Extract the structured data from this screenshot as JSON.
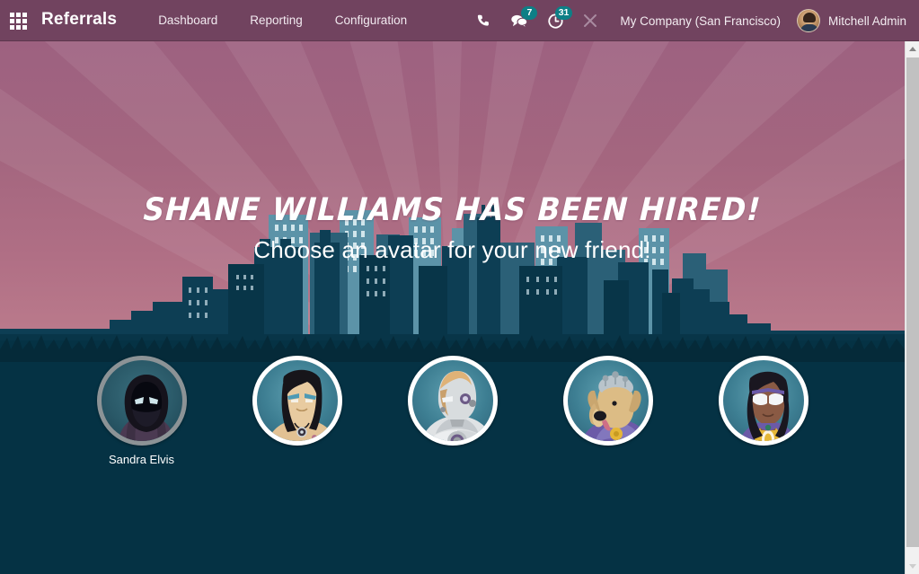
{
  "navbar": {
    "apps_icon": "apps-grid-icon",
    "brand": "Referrals",
    "menu": [
      {
        "label": "Dashboard"
      },
      {
        "label": "Reporting"
      },
      {
        "label": "Configuration"
      }
    ],
    "icons": [
      {
        "name": "phone-icon",
        "badge": null
      },
      {
        "name": "messages-icon",
        "badge": "7"
      },
      {
        "name": "activities-clock-icon",
        "badge": "31"
      },
      {
        "name": "debug-tools-icon",
        "badge": null
      }
    ],
    "company": "My Company (San Francisco)",
    "user": "Mitchell Admin",
    "badge_color": "#0d7f86",
    "bar_color": "#71435f"
  },
  "hero": {
    "title": "SHANE WILLIAMS HAS BEEN HIRED!",
    "subtitle": "Choose an avatar for your new friend!"
  },
  "avatars": [
    {
      "id": "ninja",
      "label": "Sandra Elvis",
      "selected": true
    },
    {
      "id": "rocker",
      "label": "",
      "selected": false
    },
    {
      "id": "robot",
      "label": "",
      "selected": false
    },
    {
      "id": "dog",
      "label": "",
      "selected": false
    },
    {
      "id": "superhero",
      "label": "",
      "selected": false
    }
  ],
  "theme": {
    "sky_top": "#9d6180",
    "sky_bottom": "#bb7b8c",
    "ground": "#053244",
    "building_light": "#5c93a8",
    "building_mid": "#2b6077",
    "building_dark": "#0d3e54",
    "building_darkest": "#083548"
  },
  "scrollbar": {
    "up_arrow": "chevron-up-icon",
    "down_arrow": "chevron-down-icon"
  }
}
